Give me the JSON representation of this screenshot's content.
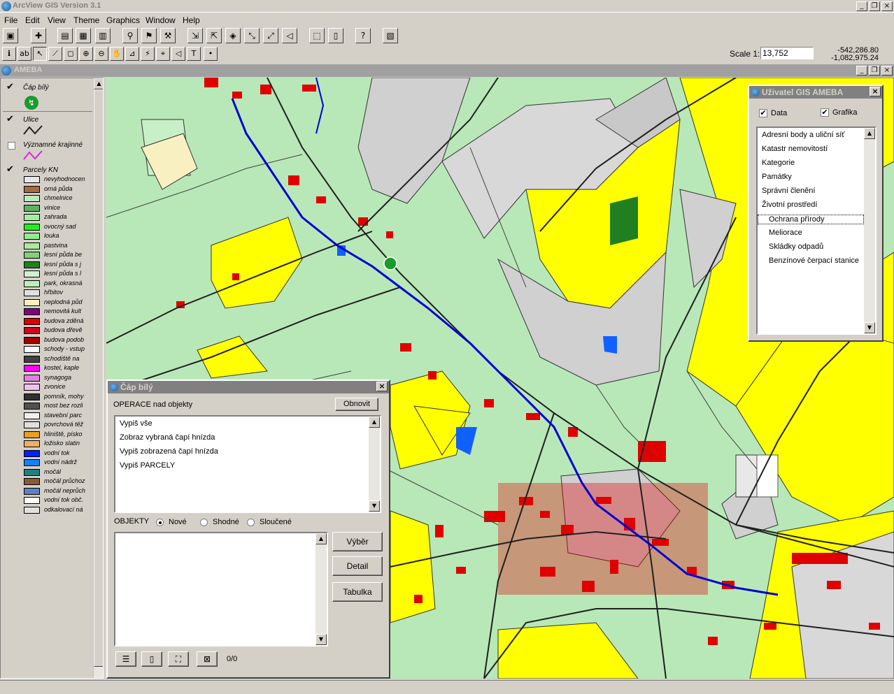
{
  "app": {
    "title": "ArcView GIS Version 3.1"
  },
  "menu": [
    "File",
    "Edit",
    "View",
    "Theme",
    "Graphics",
    "Window",
    "Help"
  ],
  "view": {
    "title": "AMEBA",
    "scale_label": "Scale 1:",
    "scale_value": "13,752",
    "coord_x": "-542,286.80",
    "coord_y": "-1,082,975.24"
  },
  "toc": {
    "themes": [
      {
        "label": "Čáp bílý",
        "checked": true
      },
      {
        "label": "Ulice",
        "checked": true
      },
      {
        "label": "Významné krajinné",
        "checked": false
      },
      {
        "label": "Parcely KN",
        "checked": true
      }
    ],
    "legend": [
      {
        "label": "nevyhodnocen",
        "color": "#e8e8e8"
      },
      {
        "label": "orná půda",
        "color": "#a86a40"
      },
      {
        "label": "chmelnice",
        "color": "#c0e8c0"
      },
      {
        "label": "vinice",
        "color": "#60b060"
      },
      {
        "label": "zahrada",
        "color": "#a0f0a0"
      },
      {
        "label": "ovocný sad",
        "color": "#20f020"
      },
      {
        "label": "louka",
        "color": "#90ee90"
      },
      {
        "label": "pastvina",
        "color": "#b0e8a0"
      },
      {
        "label": "lesní půda be",
        "color": "#80d080"
      },
      {
        "label": "lesní půda s j",
        "color": "#208020"
      },
      {
        "label": "lesní půda s l",
        "color": "#d0f0d0"
      },
      {
        "label": "park, okrasná",
        "color": "#b8f0b8"
      },
      {
        "label": "hřbitov",
        "color": "#e0e0e0"
      },
      {
        "label": "neplodná půd",
        "color": "#f8f0c0"
      },
      {
        "label": "nemovitá kult",
        "color": "#800080"
      },
      {
        "label": "budova zděná",
        "color": "#e00000"
      },
      {
        "label": "budova dřevě",
        "color": "#d00020"
      },
      {
        "label": "budova podob",
        "color": "#a00000"
      },
      {
        "label": "schody - vstup",
        "color": "#ffffff"
      },
      {
        "label": "schodiště na",
        "color": "#404040"
      },
      {
        "label": "kostel, kaple",
        "color": "#ff00ff"
      },
      {
        "label": "synagoga",
        "color": "#e080e0"
      },
      {
        "label": "zvonice",
        "color": "#f0c0f0"
      },
      {
        "label": "pomník, mohy",
        "color": "#303030"
      },
      {
        "label": "most bez rozli",
        "color": "#505050"
      },
      {
        "label": "stavební parc",
        "color": "#f0f0f0"
      },
      {
        "label": "povrchová těž",
        "color": "#e0e0e0"
      },
      {
        "label": "hliniště, písko",
        "color": "#e8a020"
      },
      {
        "label": "ložisko slatin",
        "color": "#f0b060"
      },
      {
        "label": "vodní tok",
        "color": "#0020ff"
      },
      {
        "label": "vodní nádrž",
        "color": "#1080ff"
      },
      {
        "label": "močál",
        "color": "#208080"
      },
      {
        "label": "močál průchoz",
        "color": "#8a5a30"
      },
      {
        "label": "močál neprůch",
        "color": "#6080c0"
      },
      {
        "label": "vodní tok obč.",
        "color": "#ffffff"
      },
      {
        "label": "odkalovací ná",
        "color": "#e0e0e0"
      }
    ]
  },
  "dlg_stork": {
    "title": "Čáp bílý",
    "operations_label": "OPERACE  nad objekty",
    "refresh": "Obnovit",
    "operations": [
      "Vypiš vše",
      "Zobraz vybraná čapí hnízda",
      "Vypiš zobrazená čapí hnízda",
      "Vypiš PARCELY"
    ],
    "objects_label": "OBJEKTY",
    "radio": [
      "Nové",
      "Shodné",
      "Sloučené"
    ],
    "btn_select": "Výběr",
    "btn_detail": "Detail",
    "btn_table": "Tabulka",
    "count": "0/0"
  },
  "dlg_user": {
    "title": "Uživatel GIS AMEBA",
    "data_label": "Data",
    "graphics_label": "Grafika",
    "items": [
      "Adresní body a uliční síť",
      "Katastr nemovitostí",
      "Kategorie",
      "Památky",
      "Správní členění",
      "Životní prostředí"
    ],
    "subitems": [
      "Ochrana přírody",
      "Meliorace",
      "Skládky odpadů",
      "Benzínové čerpací stanice"
    ]
  },
  "colors": {
    "field_yellow": "#ffff00",
    "meadow": "#b8e8b8",
    "built": "#e00000",
    "road": "#202020",
    "river": "#0000d0",
    "grey_parcel": "#d0d0d0"
  }
}
